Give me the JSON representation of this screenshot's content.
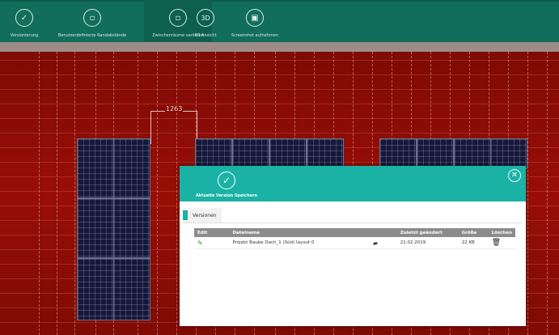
{
  "toolbar": {
    "items": [
      {
        "label": "Versionierung",
        "icon": "check-circle-icon",
        "glyph": "✓"
      },
      {
        "label": "Benutzerdefinierte Randabstände",
        "icon": "frame-circle-icon",
        "glyph": "⬚"
      },
      {
        "label": "Zwischenräume variieren",
        "icon": "spacing-circle-icon",
        "glyph": "⬚"
      },
      {
        "label": "3D Ansicht",
        "icon": "3d-circle-icon",
        "glyph": "3D"
      },
      {
        "label": "Screenshot aufnehmen",
        "icon": "camera-circle-icon",
        "glyph": "⬛"
      }
    ]
  },
  "canvas": {
    "dimension_label": "1263"
  },
  "dialog": {
    "save_label": "Aktuelle Version Speichern",
    "close_glyph": "✕",
    "tab_label": "Versionen",
    "columns": {
      "edit": "Edit",
      "filename": "Dateiname",
      "modified": "Zuletzt geändert",
      "size": "Größe",
      "delete": "Löschen"
    },
    "rows": [
      {
        "filename": "Projekt Baube Dach_1 (Süd) layout 0",
        "modified": "21.02.2019",
        "size": "22 KB"
      }
    ]
  },
  "colors": {
    "toolbar": "#116d5c",
    "dialog_header": "#19b2a5",
    "roof": "#8a0c05"
  }
}
